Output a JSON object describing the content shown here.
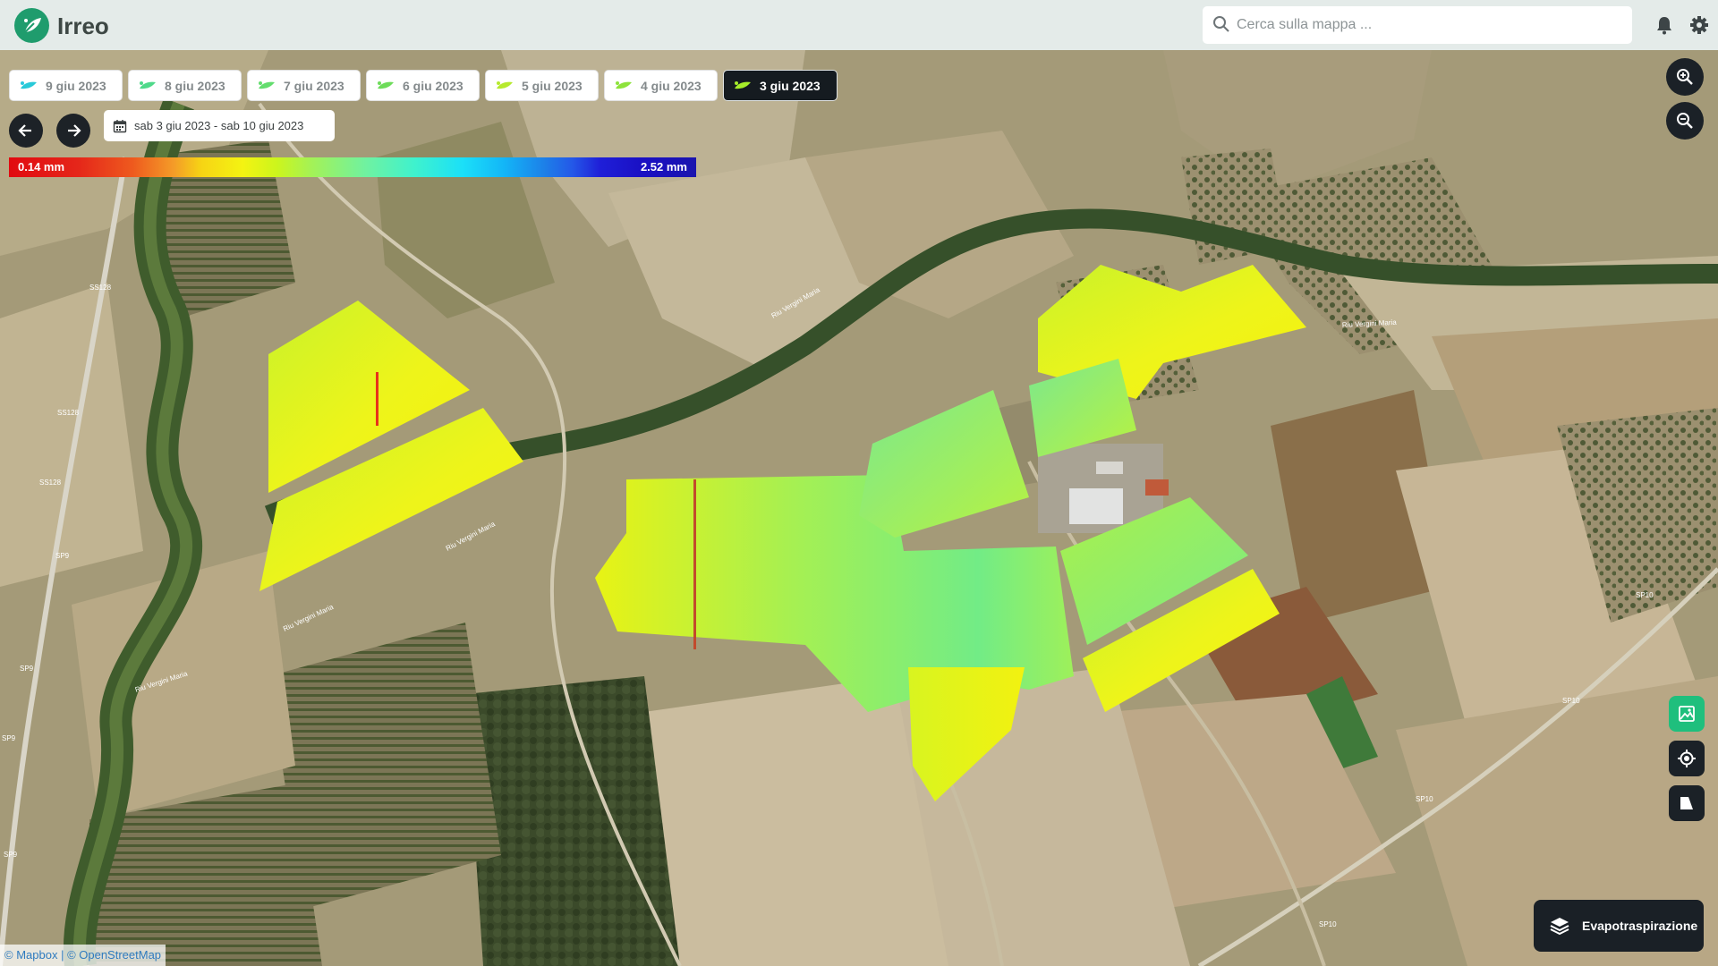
{
  "app": {
    "title": "Irreo"
  },
  "search": {
    "placeholder": "Cerca sulla mappa ..."
  },
  "date_chips": [
    {
      "label": "9 giu 2023",
      "active": false
    },
    {
      "label": "8 giu 2023",
      "active": false
    },
    {
      "label": "7 giu 2023",
      "active": false
    },
    {
      "label": "6 giu 2023",
      "active": false
    },
    {
      "label": "5 giu 2023",
      "active": false
    },
    {
      "label": "4 giu 2023",
      "active": false
    },
    {
      "label": "3 giu 2023",
      "active": true
    }
  ],
  "date_range": {
    "label": "sab 3 giu 2023 - sab 10 giu 2023"
  },
  "legend": {
    "min_label": "0.14 mm",
    "max_label": "2.52 mm"
  },
  "layer_button": {
    "label": "Evapotraspirazione"
  },
  "attribution": {
    "mapbox": "© Mapbox",
    "separator": " | ",
    "osm": "© OpenStreetMap"
  },
  "map_labels": {
    "road_ss128_a": "SS128",
    "road_ss128_b": "SS128",
    "road_ss128_c": "SS128",
    "road_sp9_a": "SP9",
    "road_sp9_b": "SP9",
    "road_sp9_c": "SP9",
    "road_sp9_d": "SP9",
    "road_sp10_a": "SP10",
    "road_sp10_b": "SP10",
    "road_sp10_c": "SP10",
    "road_sp10_d": "SP10",
    "river_a": "Riu Vergini Maria",
    "river_b": "Riu Vergini Maria",
    "river_c": "Riu Vergini Maria",
    "river_d": "Riu Vergini Maria",
    "river_e": "Riu Vergini Maria"
  },
  "colors": {
    "topbar_bg": "#e4ebe9",
    "brand": "#1f9c6d",
    "chip_active_bg": "#151b20",
    "dark_button": "#1b2127",
    "green_button": "#1fbf7d"
  },
  "icons": {
    "logo": "irreo-logo-icon",
    "search": "search-icon",
    "bell": "bell-icon",
    "settings": "gear-icon",
    "prev": "arrow-left-icon",
    "next": "arrow-right-icon",
    "calendar": "calendar-icon",
    "zoom_in": "zoom-in-icon",
    "zoom_out": "zoom-out-icon",
    "image": "image-icon",
    "locate": "target-icon",
    "shape": "polygon-icon",
    "layers": "layers-icon"
  }
}
